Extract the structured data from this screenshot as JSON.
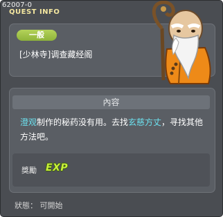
{
  "window": {
    "quest_id": "62007-0",
    "title": "QUEST INFO"
  },
  "quest": {
    "category_badge": "一般",
    "name": "[少林寺]调查藏经阁"
  },
  "content": {
    "header": "內容",
    "description": {
      "part1": "澄观",
      "part2": "制作的秘药没有用。去找",
      "part3": "玄慈方丈",
      "part4": "，寻找其他方法吧。"
    }
  },
  "reward": {
    "label": "獎勵",
    "type": "EXP"
  },
  "status": {
    "text": "狀態： 可開始"
  },
  "colors": {
    "window_bg": "#4a4d52",
    "title": "#f4e7a0",
    "badge": "#9cc146",
    "highlight": "#6ce0ee",
    "exp": "#c8f03a"
  }
}
